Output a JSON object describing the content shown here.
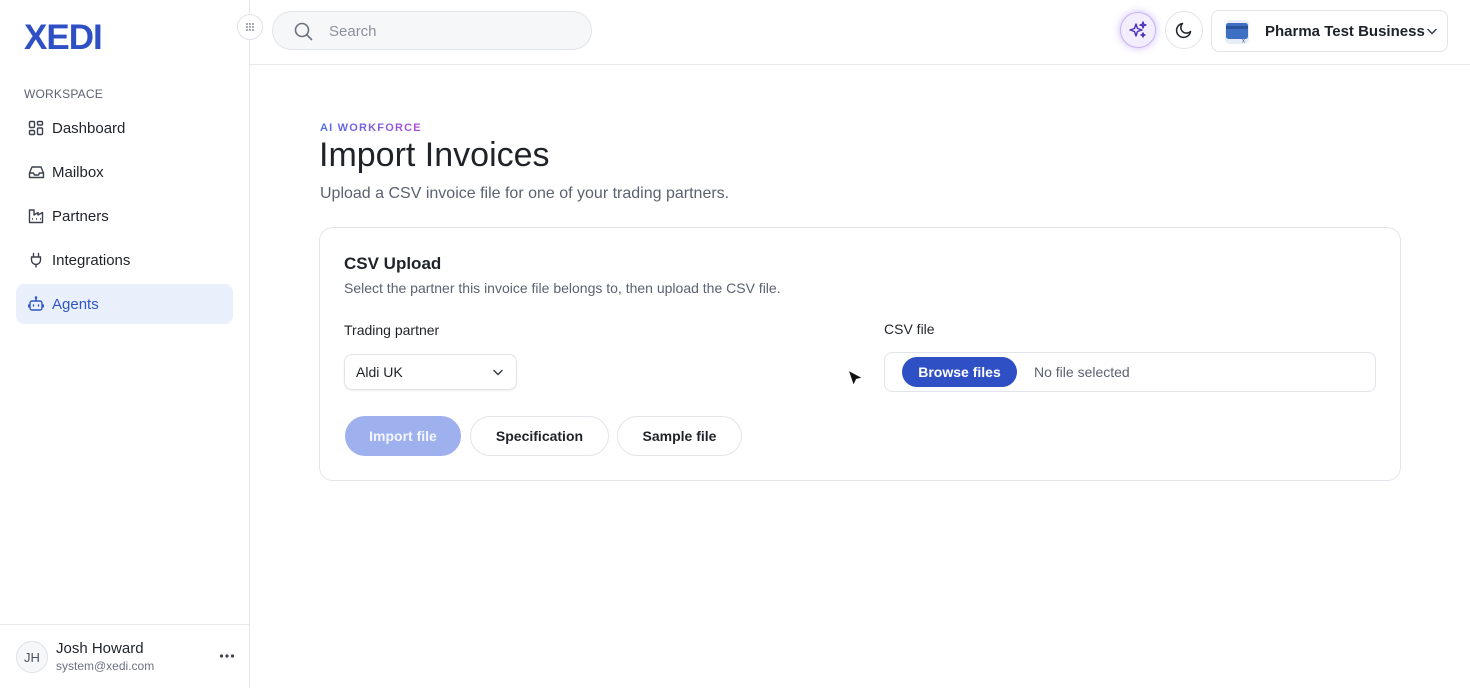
{
  "brand": {
    "logo_text": "XEDI",
    "color": "#2f4fc4"
  },
  "sidebar": {
    "section_label": "WORKSPACE",
    "items": [
      {
        "label": "Dashboard",
        "icon": "dashboard-icon"
      },
      {
        "label": "Mailbox",
        "icon": "inbox-icon"
      },
      {
        "label": "Partners",
        "icon": "partners-icon"
      },
      {
        "label": "Integrations",
        "icon": "plug-icon"
      },
      {
        "label": "Agents",
        "icon": "robot-icon",
        "active": true
      }
    ],
    "user": {
      "initials": "JH",
      "name": "Josh Howard",
      "email": "system@xedi.com"
    }
  },
  "header": {
    "search_placeholder": "Search",
    "business_name": "Pharma Test Business"
  },
  "main": {
    "eyebrow": "AI WORKFORCE",
    "title": "Import Invoices",
    "subtitle": "Upload a CSV invoice file for one of your trading partners.",
    "card": {
      "title": "CSV Upload",
      "description": "Select the partner this invoice file belongs to, then upload the CSV file.",
      "partner_label": "Trading partner",
      "partner_value": "Aldi UK",
      "file_label": "CSV file",
      "browse_label": "Browse files",
      "file_status": "No file selected",
      "buttons": {
        "import": "Import file",
        "specification": "Specification",
        "sample": "Sample file"
      }
    }
  },
  "colors": {
    "accent": "#2f4fc4",
    "active_nav_bg": "#eaf0fb",
    "import_disabled": "#9fb0ee"
  }
}
